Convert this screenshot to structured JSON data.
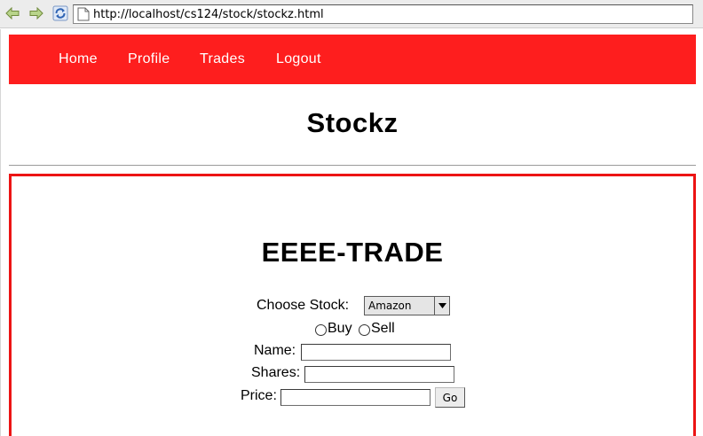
{
  "browser": {
    "url": "http://localhost/cs124/stock/stockz.html"
  },
  "nav": {
    "items": [
      {
        "label": "Home"
      },
      {
        "label": "Profile"
      },
      {
        "label": "Trades"
      },
      {
        "label": "Logout"
      }
    ]
  },
  "site": {
    "title": "Stockz"
  },
  "trade_form": {
    "heading": "EEEE-TRADE",
    "choose_stock_label": "Choose Stock:",
    "stock_selected": "Amazon",
    "buy_label": "Buy",
    "sell_label": "Sell",
    "name_label": "Name:",
    "name_value": "",
    "shares_label": "Shares:",
    "shares_value": "",
    "price_label": "Price:",
    "price_value": "",
    "go_label": "Go"
  },
  "colors": {
    "navbar": "#fe1e1e",
    "panel_border": "#ec1414"
  }
}
